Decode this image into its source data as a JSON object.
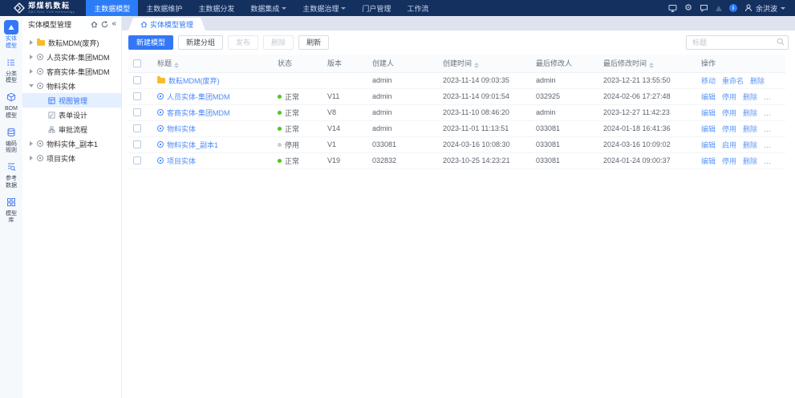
{
  "accent": "#3377f6",
  "header": {
    "brand": "郑煤机数耘",
    "tagline": "ZMJ SHU YUN technology",
    "nav": [
      {
        "label": "主数据模型"
      },
      {
        "label": "主数据维护"
      },
      {
        "label": "主数据分发"
      },
      {
        "label": "数据集成"
      },
      {
        "label": "主数据治理"
      },
      {
        "label": "门户管理"
      },
      {
        "label": "工作流"
      }
    ],
    "user": "余洪波"
  },
  "rail": [
    {
      "l1": "实体",
      "l2": "模型"
    },
    {
      "l1": "分类",
      "l2": "模型"
    },
    {
      "l1": "BOM",
      "l2": "模型"
    },
    {
      "l1": "编码",
      "l2": "规则"
    },
    {
      "l1": "参考",
      "l2": "数据"
    },
    {
      "l1": "模型",
      "l2": "库"
    }
  ],
  "sidebar": {
    "title": "实体模型管理",
    "tree": [
      {
        "label": "数耘MDM(废弃)"
      },
      {
        "label": "人员实体-集团MDM"
      },
      {
        "label": "客商实体-集团MDM"
      },
      {
        "label": "物料实体"
      },
      {
        "label": "视图管理"
      },
      {
        "label": "表单设计"
      },
      {
        "label": "审批流程"
      },
      {
        "label": "物料实体_副本1"
      },
      {
        "label": "项目实体"
      }
    ]
  },
  "main": {
    "tab": "实体模型管理",
    "toolbar": {
      "new_model": "新建模型",
      "new_group": "新建分组",
      "publish": "发布",
      "delete": "删除",
      "refresh": "刷新",
      "search_placeholder": "标题"
    },
    "table": {
      "columns": [
        "标题",
        "状态",
        "版本",
        "创建人",
        "创建时间",
        "最后修改人",
        "最后修改时间",
        "操作"
      ],
      "status_colors": {
        "normal": "#52c41a",
        "disabled": "#c9ced6"
      },
      "rows": [
        {
          "title": "数耘MDM(废弃)",
          "status": "",
          "dot": "",
          "version": "",
          "creator": "admin",
          "created": "2023-11-14 09:03:35",
          "modifier": "admin",
          "modified": "2023-12-21 13:55:50",
          "a0": "移动",
          "a1": "重命名",
          "a2": "删除",
          "a3": ""
        },
        {
          "title": "人员实体-集团MDM",
          "status": "正常",
          "dot": "#52c41a",
          "version": "V11",
          "creator": "admin",
          "created": "2023-11-14 09:01:54",
          "modifier": "032925",
          "modified": "2024-02-06 17:27:48",
          "a0": "编辑",
          "a1": "停用",
          "a2": "删除",
          "a3": "…"
        },
        {
          "title": "客商实体-集团MDM",
          "status": "正常",
          "dot": "#52c41a",
          "version": "V8",
          "creator": "admin",
          "created": "2023-11-10 08:46:20",
          "modifier": "admin",
          "modified": "2023-12-27 11:42:23",
          "a0": "编辑",
          "a1": "停用",
          "a2": "删除",
          "a3": "…"
        },
        {
          "title": "物料实体",
          "status": "正常",
          "dot": "#52c41a",
          "version": "V14",
          "creator": "admin",
          "created": "2023-11-01 11:13:51",
          "modifier": "033081",
          "modified": "2024-01-18 16:41:36",
          "a0": "编辑",
          "a1": "停用",
          "a2": "删除",
          "a3": "…"
        },
        {
          "title": "物料实体_副本1",
          "status": "停用",
          "dot": "#c9ced6",
          "version": "V1",
          "creator": "033081",
          "created": "2024-03-16 10:08:30",
          "modifier": "033081",
          "modified": "2024-03-16 10:09:02",
          "a0": "编辑",
          "a1": "启用",
          "a2": "删除",
          "a3": "…"
        },
        {
          "title": "项目实体",
          "status": "正常",
          "dot": "#52c41a",
          "version": "V19",
          "creator": "032832",
          "created": "2023-10-25 14:23:21",
          "modifier": "033081",
          "modified": "2024-01-24 09:00:37",
          "a0": "编辑",
          "a1": "停用",
          "a2": "删除",
          "a3": "…"
        }
      ]
    }
  }
}
